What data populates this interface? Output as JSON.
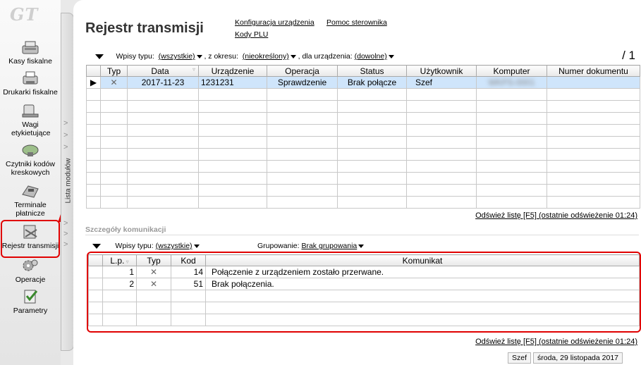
{
  "app": {
    "logo": "GT"
  },
  "sidebar": {
    "items": [
      {
        "label": "Kasy fiskalne",
        "icon": "cash-register-icon"
      },
      {
        "label": "Drukarki fiskalne",
        "icon": "fiscal-printer-icon"
      },
      {
        "label": "Wagi etykietujące",
        "icon": "label-scale-icon"
      },
      {
        "label": "Czytniki kodów kreskowych",
        "icon": "barcode-scanner-icon"
      },
      {
        "label": "Terminale płatnicze",
        "icon": "payment-terminal-icon"
      },
      {
        "label": "Rejestr transmisji",
        "icon": "transmission-log-icon",
        "active": true
      },
      {
        "label": "Operacje",
        "icon": "gears-icon"
      },
      {
        "label": "Parametry",
        "icon": "checklist-icon"
      }
    ],
    "module_strip_label": "Lista modułów"
  },
  "header": {
    "title": "Rejestr transmisji",
    "links": [
      "Konfiguracja urządzenia",
      "Pomoc sterownika",
      "Kody PLU"
    ]
  },
  "filters": {
    "entry_type_label": "Wpisy typu:",
    "entry_type_value": "(wszystkie)",
    "period_label": ", z okresu:",
    "period_value": "(nieokreślony)",
    "device_label": ", dla urządzenia:",
    "device_value": "(dowolne)",
    "page_indicator": "/ 1"
  },
  "transmissions": {
    "columns": [
      "Typ",
      "Data",
      "Urządzenie",
      "Operacja",
      "Status",
      "Użytkownik",
      "Komputer",
      "Numer dokumentu"
    ],
    "rows": [
      {
        "selected": true,
        "type_icon": "x-mark-icon",
        "date": "2017-11-23",
        "device": "1231231",
        "operation": "Sprawdzenie",
        "status": "Brak połącze",
        "user": "Szef",
        "computer": "WKPS-0001",
        "doc": ""
      }
    ]
  },
  "refresh": {
    "label": "Odśwież listę [F5] (ostatnie odświeżenie 01:24)"
  },
  "details": {
    "section_title": "Szczegóły komunikacji",
    "entry_type_label": "Wpisy typu:",
    "entry_type_value": "(wszystkie)",
    "grouping_label": "Grupowanie:",
    "grouping_value": "Brak grupowania",
    "columns": [
      "L.p.",
      "Typ",
      "Kod",
      "Komunikat"
    ],
    "rows": [
      {
        "lp": "1",
        "type_icon": "x-mark-icon",
        "code": "14",
        "message": "Połączenie z urządzeniem zostało przerwane."
      },
      {
        "lp": "2",
        "type_icon": "x-mark-icon",
        "code": "51",
        "message": "Brak połączenia."
      }
    ]
  },
  "statusbar": {
    "user": "Szef",
    "date": "środa, 29 listopada 2017"
  },
  "colors": {
    "highlight": "#e00000",
    "selection": "#cfe5fb"
  }
}
